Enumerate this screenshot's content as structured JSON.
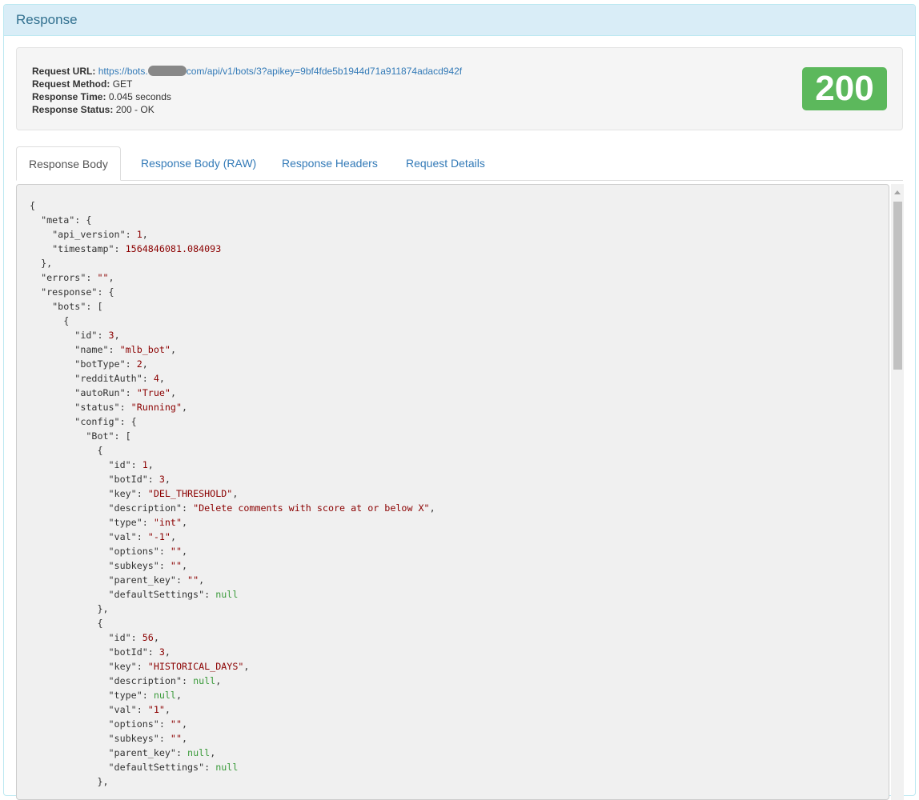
{
  "panel": {
    "title": "Response"
  },
  "request": {
    "url_label": "Request URL:",
    "url_prefix": "https://bots.",
    "url_suffix": "com/api/v1/bots/3?apikey=9bf4fde5b1944d71a911874adacd942f",
    "method_label": "Request Method:",
    "method": "GET",
    "time_label": "Response Time:",
    "time": "0.045 seconds",
    "status_label": "Response Status:",
    "status": "200 - OK",
    "status_code": "200",
    "status_color": "#5cb85c"
  },
  "tabs": [
    "Response Body",
    "Response Body (RAW)",
    "Response Headers",
    "Request Details"
  ],
  "active_tab": 0,
  "code_lines": [
    [
      0,
      "{",
      ""
    ],
    [
      1,
      "\"meta\": {",
      ""
    ],
    [
      2,
      "\"api_version\": ",
      "1",
      "n",
      ","
    ],
    [
      2,
      "\"timestamp\": ",
      "1564846081.084093",
      "n",
      ""
    ],
    [
      1,
      "},",
      ""
    ],
    [
      1,
      "\"errors\": ",
      "\"\"",
      "s",
      ","
    ],
    [
      1,
      "\"response\": {",
      ""
    ],
    [
      2,
      "\"bots\": [",
      ""
    ],
    [
      3,
      "{",
      ""
    ],
    [
      4,
      "\"id\": ",
      "3",
      "n",
      ","
    ],
    [
      4,
      "\"name\": ",
      "\"mlb_bot\"",
      "s",
      ","
    ],
    [
      4,
      "\"botType\": ",
      "2",
      "n",
      ","
    ],
    [
      4,
      "\"redditAuth\": ",
      "4",
      "n",
      ","
    ],
    [
      4,
      "\"autoRun\": ",
      "\"True\"",
      "s",
      ","
    ],
    [
      4,
      "\"status\": ",
      "\"Running\"",
      "s",
      ","
    ],
    [
      4,
      "\"config\": {",
      ""
    ],
    [
      5,
      "\"Bot\": [",
      ""
    ],
    [
      6,
      "{",
      ""
    ],
    [
      7,
      "\"id\": ",
      "1",
      "n",
      ","
    ],
    [
      7,
      "\"botId\": ",
      "3",
      "n",
      ","
    ],
    [
      7,
      "\"key\": ",
      "\"DEL_THRESHOLD\"",
      "s",
      ","
    ],
    [
      7,
      "\"description\": ",
      "\"Delete comments with score at or below X\"",
      "s",
      ","
    ],
    [
      7,
      "\"type\": ",
      "\"int\"",
      "s",
      ","
    ],
    [
      7,
      "\"val\": ",
      "\"-1\"",
      "s",
      ","
    ],
    [
      7,
      "\"options\": ",
      "\"\"",
      "s",
      ","
    ],
    [
      7,
      "\"subkeys\": ",
      "\"\"",
      "s",
      ","
    ],
    [
      7,
      "\"parent_key\": ",
      "\"\"",
      "s",
      ","
    ],
    [
      7,
      "\"defaultSettings\": ",
      "null",
      "nl",
      ""
    ],
    [
      6,
      "},",
      ""
    ],
    [
      6,
      "{",
      ""
    ],
    [
      7,
      "\"id\": ",
      "56",
      "n",
      ","
    ],
    [
      7,
      "\"botId\": ",
      "3",
      "n",
      ","
    ],
    [
      7,
      "\"key\": ",
      "\"HISTORICAL_DAYS\"",
      "s",
      ","
    ],
    [
      7,
      "\"description\": ",
      "null",
      "nl",
      ","
    ],
    [
      7,
      "\"type\": ",
      "null",
      "nl",
      ","
    ],
    [
      7,
      "\"val\": ",
      "\"1\"",
      "s",
      ","
    ],
    [
      7,
      "\"options\": ",
      "\"\"",
      "s",
      ","
    ],
    [
      7,
      "\"subkeys\": ",
      "\"\"",
      "s",
      ","
    ],
    [
      7,
      "\"parent_key\": ",
      "null",
      "nl",
      ","
    ],
    [
      7,
      "\"defaultSettings\": ",
      "null",
      "nl",
      ""
    ],
    [
      6,
      "},",
      ""
    ]
  ]
}
